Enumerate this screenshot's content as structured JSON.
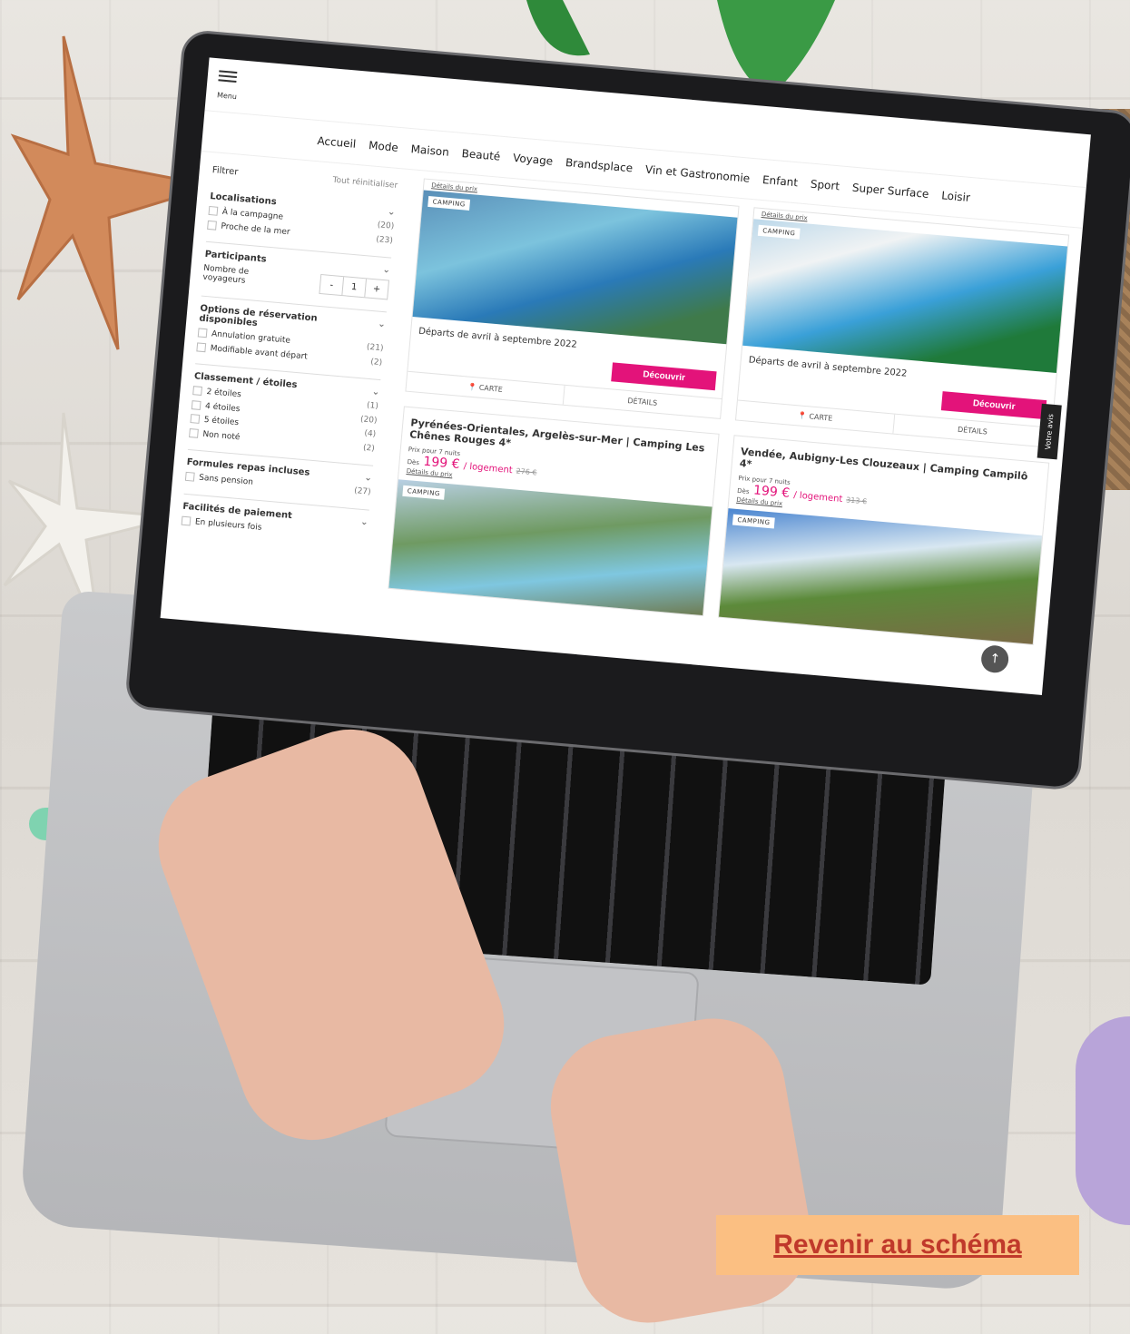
{
  "nav": {
    "menu_label": "Menu",
    "items": [
      "Accueil",
      "Mode",
      "Maison",
      "Beauté",
      "Voyage",
      "Brandsplace",
      "Vin et Gastronomie",
      "Enfant",
      "Sport",
      "Super Surface",
      "Loisir"
    ]
  },
  "filters": {
    "title": "Filtrer",
    "reset": "Tout réinitialiser",
    "localisations": {
      "title": "Localisations",
      "options": [
        {
          "label": "À la campagne",
          "count": "(20)"
        },
        {
          "label": "Proche de la mer",
          "count": "(23)"
        }
      ]
    },
    "participants": {
      "title": "Participants",
      "label": "Nombre de voyageurs",
      "minus": "-",
      "value": "1",
      "plus": "+"
    },
    "reservation": {
      "title": "Options de réservation disponibles",
      "options": [
        {
          "label": "Annulation gratuite",
          "count": "(21)"
        },
        {
          "label": "Modifiable avant départ",
          "count": "(2)"
        }
      ]
    },
    "classement": {
      "title": "Classement / étoiles",
      "options": [
        {
          "label": "2 étoiles",
          "count": "(1)"
        },
        {
          "label": "4 étoiles",
          "count": "(20)"
        },
        {
          "label": "5 étoiles",
          "count": "(4)"
        },
        {
          "label": "Non noté",
          "count": "(2)"
        }
      ]
    },
    "repas": {
      "title": "Formules repas incluses",
      "options": [
        {
          "label": "Sans pension",
          "count": "(27)"
        }
      ]
    },
    "paiement": {
      "title": "Facilités de paiement",
      "options": [
        {
          "label": "En plusieurs fois",
          "count": ""
        }
      ]
    }
  },
  "cards": [
    {
      "tag": "CAMPING",
      "dates": "Départs de avril à septembre 2022",
      "cta": "Découvrir",
      "map": "CARTE",
      "details": "DÉTAILS",
      "details_link": "Détails du prix"
    },
    {
      "tag": "CAMPING",
      "dates": "Départs de avril à septembre 2022",
      "cta": "Découvrir",
      "map": "CARTE",
      "details": "DÉTAILS",
      "details_link": "Détails du prix"
    },
    {
      "tag": "CAMPING",
      "title": "Pyrénées-Orientales, Argelès-sur-Mer | Camping Les Chênes Rouges 4*",
      "price_label": "Prix pour 7 nuits",
      "from": "Dès",
      "price": "199 €",
      "unit": "/ logement",
      "old": "276 €",
      "details_link": "Détails du prix"
    },
    {
      "tag": "CAMPING",
      "title": "Vendée, Aubigny-Les Clouzeaux | Camping Campilô 4*",
      "price_label": "Prix pour 7 nuits",
      "from": "Dès",
      "price": "199 €",
      "unit": "/ logement",
      "old": "313 €",
      "details_link": "Détails du prix"
    }
  ],
  "side_tab": "Votre avis",
  "back_button": "Revenir au schéma"
}
